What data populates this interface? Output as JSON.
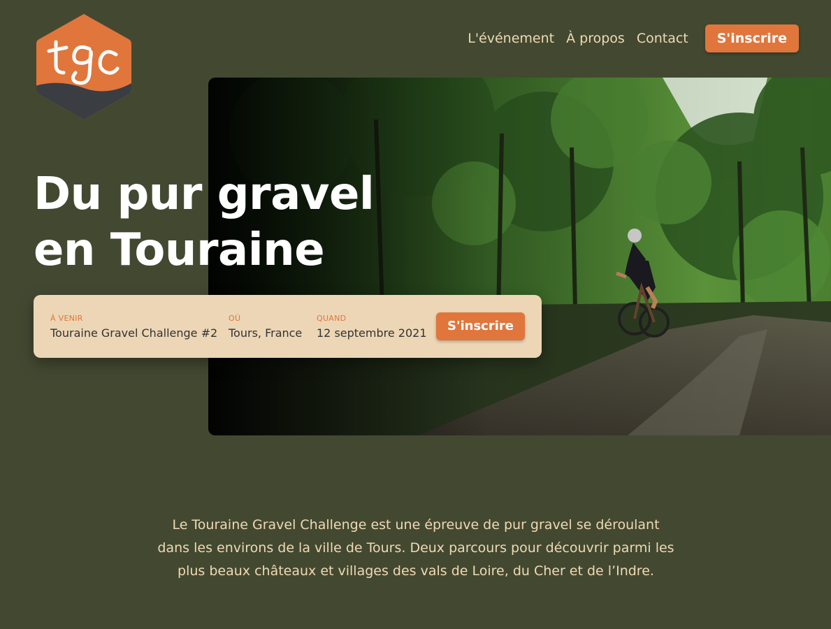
{
  "logo": {
    "text": "tgc",
    "colors": {
      "orange": "#e0763c",
      "dark": "#3a3d42",
      "line": "#ffffff"
    }
  },
  "nav": {
    "links": [
      "L'événement",
      "À propos",
      "Contact"
    ],
    "cta": "S'inscrire"
  },
  "hero": {
    "headline_line1": "Du pur gravel",
    "headline_line2": "en Touraine",
    "image_description": "gravel-cyclist-forest-path-photo"
  },
  "event_card": {
    "upcoming_label": "À VENIR",
    "upcoming_value": "Touraine Gravel Challenge #2",
    "where_label": "OÙ",
    "where_value": "Tours, France",
    "when_label": "QUAND",
    "when_value": "12 septembre 2021",
    "cta": "S'inscrire"
  },
  "intro": {
    "text": "Le Touraine Gravel Challenge est une épreuve de pur gravel se déroulant dans les environs de la ville de Tours. Deux parcours pour découvrir parmi les plus beaux châteaux et villages des vals de Loire, du Cher et de l’Indre."
  },
  "colors": {
    "background": "#434931",
    "accent": "#e0763c",
    "cream": "#ecd6b6",
    "nav_text": "#f0d9b5"
  }
}
